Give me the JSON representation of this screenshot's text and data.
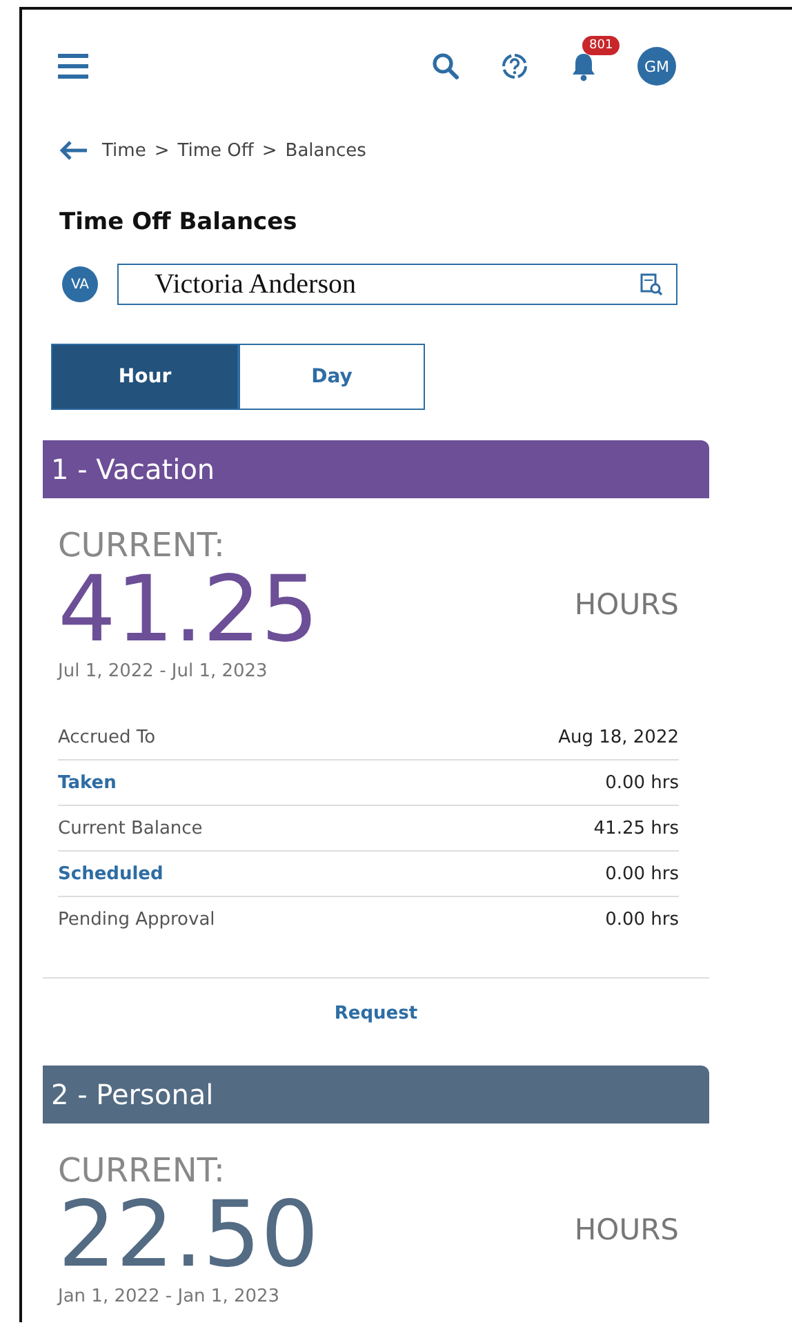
{
  "header": {
    "notification_count": "801",
    "avatar": "GM"
  },
  "breadcrumb": [
    "Time",
    ">",
    "Time Off",
    ">",
    "Balances"
  ],
  "title": "Time Off Balances",
  "employee": {
    "avatar": "VA",
    "value": "Victoria Anderson"
  },
  "unit_toggle": [
    {
      "label": "Hour",
      "selected": true
    },
    {
      "label": "Day",
      "selected": false
    }
  ],
  "cards": [
    {
      "title": "1 - Vacation",
      "color": "#6c4f97",
      "current_label": "CURRENT:",
      "amount": "41.25",
      "unit": "HOURS",
      "period": "Jul 1, 2022 - Jul 1, 2023",
      "rows": [
        {
          "kind": "text",
          "label": "Accrued To",
          "value": "Aug 18, 2022"
        },
        {
          "kind": "link",
          "label": "Taken",
          "value": "0.00 hrs"
        },
        {
          "kind": "text",
          "label": "Current Balance",
          "value": "41.25 hrs"
        },
        {
          "kind": "link",
          "label": "Scheduled",
          "value": "0.00 hrs"
        },
        {
          "kind": "text",
          "label": "Pending Approval",
          "value": "0.00 hrs"
        }
      ],
      "action": "Request"
    },
    {
      "title": "2 - Personal",
      "color": "#536b83",
      "current_label": "CURRENT:",
      "amount": "22.50",
      "unit": "HOURS",
      "period": "Jan 1, 2022 - Jan 1, 2023"
    }
  ]
}
